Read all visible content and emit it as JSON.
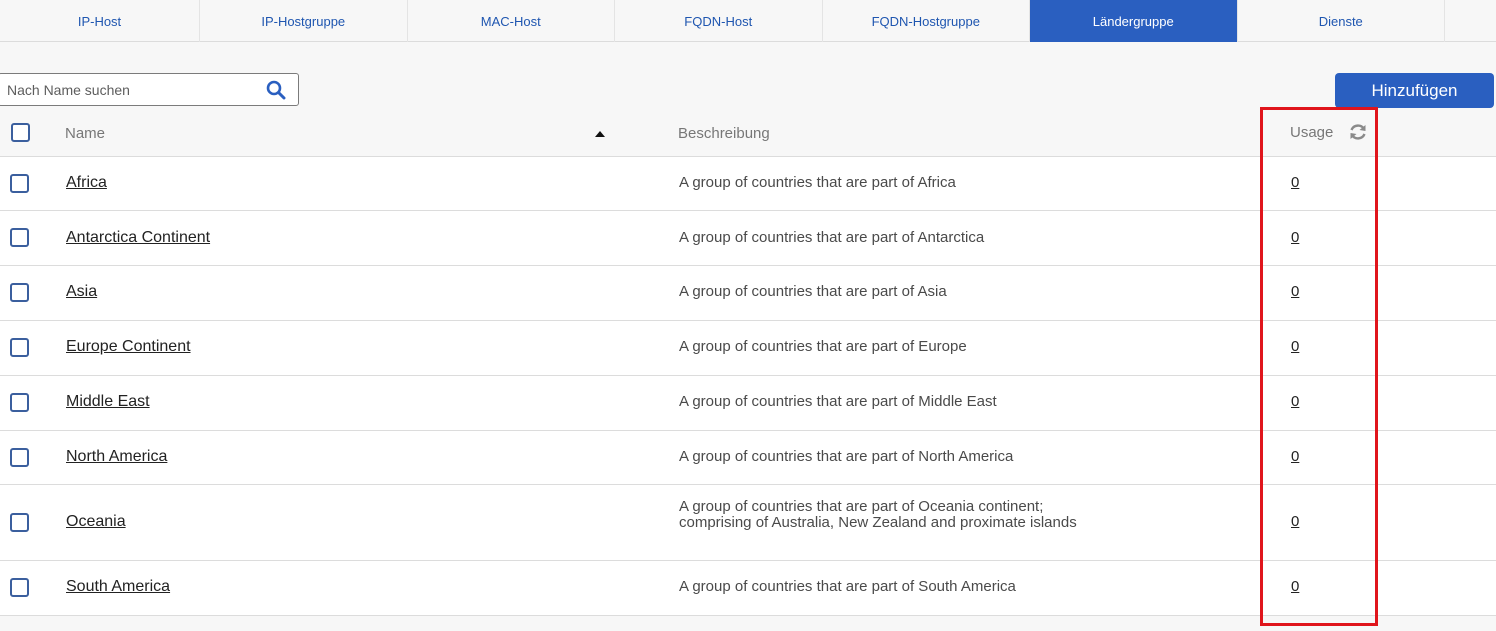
{
  "tabs": [
    {
      "label": "IP-Host"
    },
    {
      "label": "IP-Hostgruppe"
    },
    {
      "label": "MAC-Host"
    },
    {
      "label": "FQDN-Host"
    },
    {
      "label": "FQDN-Hostgruppe"
    },
    {
      "label": "Ländergruppe",
      "active": true
    },
    {
      "label": "Dienste"
    }
  ],
  "search": {
    "placeholder": "Nach Name suchen",
    "icon": "search-icon"
  },
  "add_button": {
    "label": "Hinzufügen"
  },
  "table": {
    "columns": {
      "name": "Name",
      "description": "Beschreibung",
      "usage": "Usage"
    },
    "sort": {
      "column": "Name",
      "direction": "ascending"
    },
    "rows": [
      {
        "name": "Africa",
        "description": "A group of countries that are part of Africa",
        "usage": "0"
      },
      {
        "name": "Antarctica Continent",
        "description": "A group of countries that are part of Antarctica",
        "usage": "0"
      },
      {
        "name": "Asia",
        "description": "A group of countries that are part of Asia",
        "usage": "0"
      },
      {
        "name": "Europe Continent",
        "description": "A group of countries that are part of Europe",
        "usage": "0"
      },
      {
        "name": "Middle East",
        "description": "A group of countries that are part of Middle East",
        "usage": "0"
      },
      {
        "name": "North America",
        "description": "A group of countries that are part of North America",
        "usage": "0"
      },
      {
        "name": "Oceania",
        "description": "A group of countries that are part of Oceania continent; comprising of Australia, New Zealand and proximate islands",
        "usage": "0"
      },
      {
        "name": "South America",
        "description": "A group of countries that are part of South America",
        "usage": "0"
      }
    ]
  },
  "colors": {
    "accent": "#2a5fc0",
    "highlight": "#e0151c"
  }
}
